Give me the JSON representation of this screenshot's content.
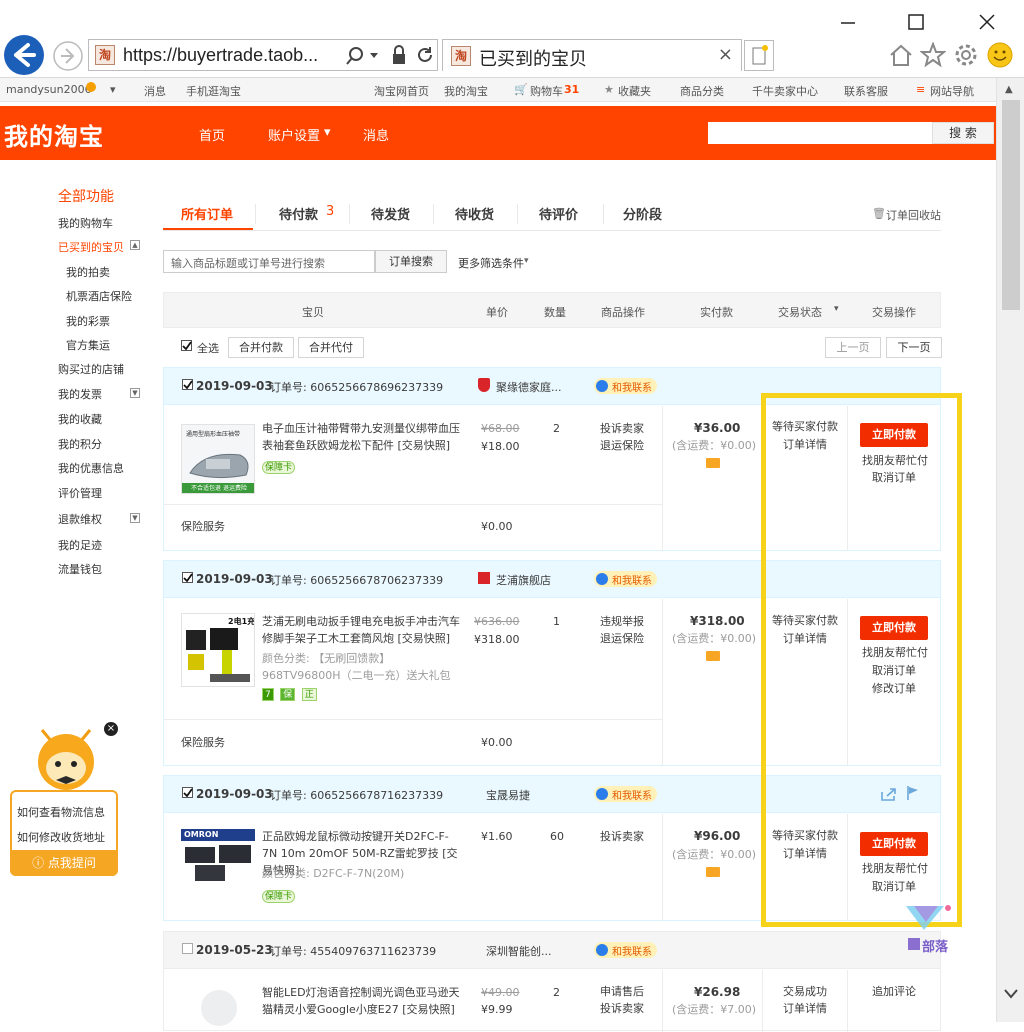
{
  "browser": {
    "url": "https://buyertrade.taob...",
    "tab_title": "已买到的宝贝",
    "favicon_label": "淘"
  },
  "topbar": {
    "username": "mandysun2006",
    "messages": "消息",
    "mobile": "手机逛淘宝",
    "home": "淘宝网首页",
    "my_taobao": "我的淘宝",
    "cart": "购物车",
    "cart_count": "31",
    "favorites": "收藏夹",
    "categories": "商品分类",
    "seller_center": "千牛卖家中心",
    "service": "联系客服",
    "site_nav": "网站导航"
  },
  "header": {
    "logo": "我的淘宝",
    "nav": [
      "首页",
      "账户设置",
      "消息"
    ],
    "search_btn": "搜 索"
  },
  "sidebar": {
    "title": "全部功能",
    "items": [
      "我的购物车",
      "已买到的宝贝",
      "我的拍卖",
      "机票酒店保险",
      "我的彩票",
      "官方集运",
      "购买过的店铺",
      "我的发票",
      "我的收藏",
      "我的积分",
      "我的优惠信息",
      "评价管理",
      "退款维权",
      "我的足迹",
      "流量钱包"
    ]
  },
  "tabs": {
    "all": "所有订单",
    "pending_pay": "待付款",
    "pending_pay_count": "3",
    "pending_ship": "待发货",
    "pending_receive": "待收货",
    "pending_review": "待评价",
    "installment": "分阶段",
    "recycle": "订单回收站"
  },
  "filters": {
    "search_placeholder": "输入商品标题或订单号进行搜索",
    "search_btn": "订单搜索",
    "more": "更多筛选条件"
  },
  "table_head": {
    "item": "宝贝",
    "price": "单价",
    "qty": "数量",
    "item_ops": "商品操作",
    "paid": "实付款",
    "status": "交易状态",
    "ops": "交易操作"
  },
  "bulk": {
    "select_all": "全选",
    "merge_pay": "合并付款",
    "merge_proxy": "合并代付",
    "prev": "上一页",
    "next": "下一页"
  },
  "orders": [
    {
      "date": "2019-09-03",
      "order_no_label": "订单号: 6065256678696237339",
      "shop": "聚缘德家庭...",
      "contact": "和我联系",
      "title": "电子血压计袖带臂带九安测量仪绑带血压表袖套鱼跃欧姆龙松下配件 [交易快照]",
      "badge": "保障卡",
      "thumb_label": "通用型扇形血压袖带",
      "thumb_banner": "不合适包退 退运费险",
      "orig_price": "¥68.00",
      "price": "¥18.00",
      "qty": "2",
      "item_ops": [
        "投诉卖家",
        "退运保险"
      ],
      "paid": "¥36.00",
      "shipping": "(含运费：¥0.00)",
      "status": [
        "等待买家付款",
        "订单详情"
      ],
      "pay_btn": "立即付款",
      "ops": [
        "找朋友帮忙付",
        "取消订单"
      ],
      "service": "保险服务",
      "service_price": "¥0.00"
    },
    {
      "date": "2019-09-03",
      "order_no_label": "订单号: 6065256678706237339",
      "shop": "芝浦旗舰店",
      "contact": "和我联系",
      "title": "芝浦无刷电动扳手锂电充电扳手冲击汽车修脚手架子工木工套筒风炮 [交易快照]",
      "sku": "颜色分类: 【无刷回馈款】968TV96800H（二电一充）送大礼包",
      "thumb_label": "2电1充",
      "orig_price": "¥636.00",
      "price": "¥318.00",
      "qty": "1",
      "item_ops": [
        "违规举报",
        "退运保险"
      ],
      "paid": "¥318.00",
      "shipping": "(含运费：¥0.00)",
      "status": [
        "等待买家付款",
        "订单详情"
      ],
      "pay_btn": "立即付款",
      "ops": [
        "找朋友帮忙付",
        "取消订单",
        "修改订单"
      ],
      "service": "保险服务",
      "service_price": "¥0.00",
      "tags": [
        "7",
        "保",
        "正"
      ]
    },
    {
      "date": "2019-09-03",
      "order_no_label": "订单号: 6065256678716237339",
      "shop": "宝晟易捷",
      "contact": "和我联系",
      "title": "正品欧姆龙鼠标微动按键开关D2FC-F-7N 10m 20mOF 50M-RZ雷蛇罗技 [交易快照]",
      "sku": "颜色分类: D2FC-F-7N(20M)",
      "badge": "保障卡",
      "thumb_label": "OMRON",
      "price": "¥1.60",
      "qty": "60",
      "item_ops": [
        "投诉卖家"
      ],
      "paid": "¥96.00",
      "shipping": "(含运费：¥0.00)",
      "status": [
        "等待买家付款",
        "订单详情"
      ],
      "pay_btn": "立即付款",
      "ops": [
        "找朋友帮忙付",
        "取消订单"
      ]
    },
    {
      "date": "2019-05-23",
      "order_no_label": "订单号: 455409763711623739",
      "shop": "深圳智能创...",
      "contact": "和我联系",
      "title": "智能LED灯泡语音控制调光调色亚马逊天猫精灵小爱Google小度E27 [交易快照]",
      "orig_price": "¥49.00",
      "price": "¥9.99",
      "qty": "2",
      "item_ops": [
        "申请售后",
        "投诉卖家"
      ],
      "paid": "¥26.98",
      "shipping": "(含运费：¥7.00)",
      "status": [
        "交易成功",
        "订单详情"
      ],
      "ops": [
        "追加评论"
      ]
    }
  ],
  "assistant": {
    "q1": "如何查看物流信息",
    "q2": "如何修改收货地址",
    "ask": "点我提问"
  },
  "watermark": "部落",
  "colors": {
    "brand": "#ff4400",
    "pay_button": "#f22e00",
    "highlight": "#f6d21a",
    "order_header": "#eaf8ff"
  }
}
